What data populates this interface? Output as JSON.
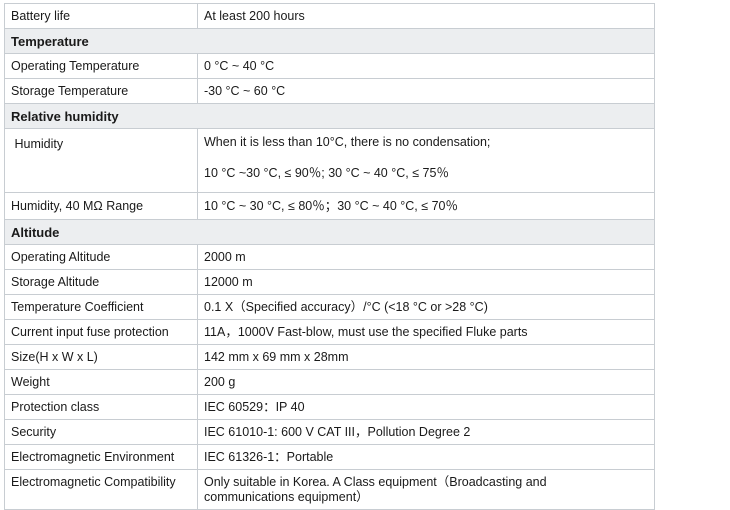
{
  "rows": [
    {
      "label": "Battery life",
      "value": "At least 200 hours"
    },
    {
      "section": "Temperature"
    },
    {
      "label": "Operating Temperature",
      "value": "0 °C ~ 40 °C"
    },
    {
      "label": "Storage Temperature",
      "value": "-30 °C ~ 60 °C"
    },
    {
      "section": "Relative humidity"
    },
    {
      "label": " Humidity",
      "value_lines": [
        "When it is less than 10°C, there is no condensation;",
        "10 °C ~30 °C, ≤ 90％; 30 °C ~ 40 °C, ≤ 75％"
      ]
    },
    {
      "label": "Humidity, 40 MΩ Range",
      "value": "10 °C ~ 30 °C, ≤ 80％；30 °C ~ 40 °C, ≤ 70％"
    },
    {
      "section": "Altitude"
    },
    {
      "label": "Operating Altitude",
      "value": "2000 m"
    },
    {
      "label": "Storage Altitude",
      "value": "12000 m"
    },
    {
      "label": "Temperature Coefficient",
      "value": "0.1 X（Specified accuracy）/°C (<18 °C or >28 °C)"
    },
    {
      "label": "Current input fuse protection",
      "value": "11A，1000V Fast-blow, must use the specified Fluke parts"
    },
    {
      "label": "Size(H x W x L)",
      "value": "142 mm x 69 mm x 28mm"
    },
    {
      "label": "Weight",
      "value": "200 g"
    },
    {
      "label": "Protection class",
      "value": "IEC 60529：IP 40"
    },
    {
      "label": "Security",
      "value": "IEC 61010-1: 600 V CAT III，Pollution Degree 2"
    },
    {
      "label": "Electromagnetic Environment",
      "value": "IEC 61326-1：Portable"
    },
    {
      "label": "Electromagnetic Compatibility",
      "value_lines": [
        "Only suitable in Korea.  A Class equipment（Broadcasting and",
        "communications equipment）"
      ]
    }
  ]
}
